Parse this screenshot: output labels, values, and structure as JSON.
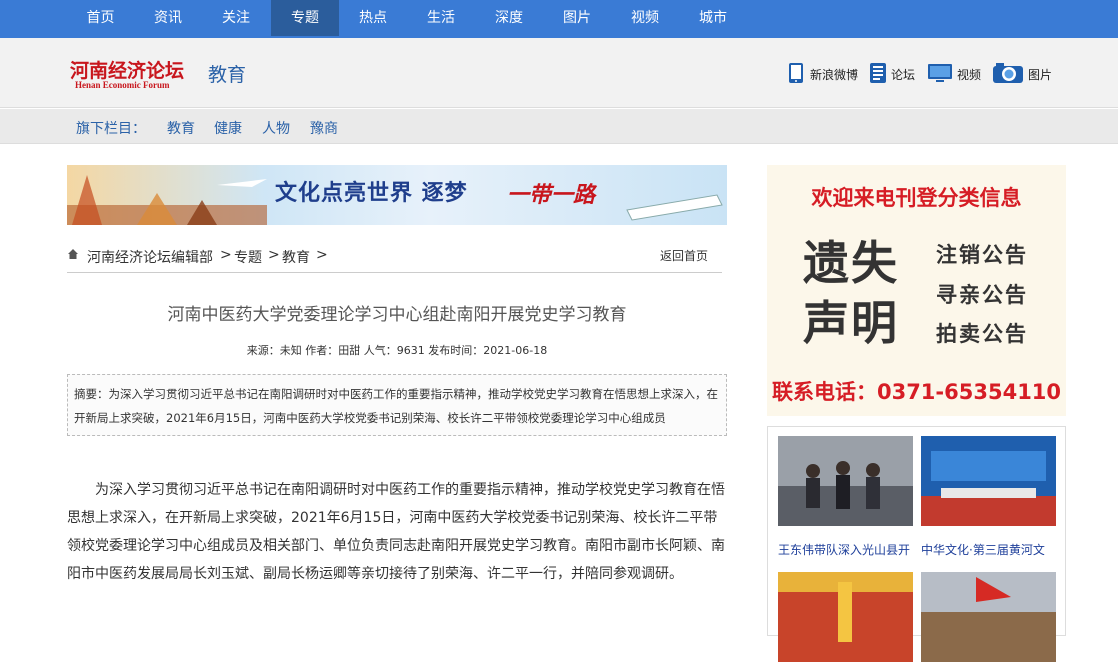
{
  "topnav": [
    "首页",
    "资讯",
    "关注",
    "专题",
    "热点",
    "生活",
    "深度",
    "图片",
    "视频",
    "城市"
  ],
  "header": {
    "logo": "河南经济论坛",
    "logo_en": "Henan Economic Forum",
    "channel": "教育",
    "links": [
      "新浪微博",
      "论坛",
      "视频",
      "图片"
    ]
  },
  "subnav": {
    "label": "旗下栏目：",
    "items": [
      "教育",
      "健康",
      "人物",
      "豫商"
    ]
  },
  "banner": {
    "text": "文化点亮世界  逐梦",
    "text2": "一带一路"
  },
  "breadcrumb": {
    "items": [
      "河南经济论坛编辑部",
      "专题",
      "教育"
    ],
    "sep": ">",
    "back": "返回首页"
  },
  "article": {
    "title": "河南中医药大学党委理论学习中心组赴南阳开展党史学习教育",
    "meta": "来源：未知 作者：田甜 人气：9631 发布时间：2021-06-18",
    "summary": "摘要：为深入学习贯彻习近平总书记在南阳调研时对中医药工作的重要指示精神，推动学校党史学习教育在悟思想上求深入，在开新局上求突破，2021年6月15日，河南中医药大学校党委书记别荣海、校长许二平带领校党委理论学习中心组成员",
    "body": "为深入学习贯彻习近平总书记在南阳调研时对中医药工作的重要指示精神，推动学校党史学习教育在悟思想上求深入，在开新局上求突破，2021年6月15日，河南中医药大学校党委书记别荣海、校长许二平带领校党委理论学习中心组成员及相关部门、单位负责同志赴南阳开展党史学习教育。南阳市副市长阿颖、南阳市中医药发展局局长刘玉斌、副局长杨运卿等亲切接待了别荣海、许二平一行，并陪同参观调研。"
  },
  "ad": {
    "top": "欢迎来电刊登分类信息",
    "big1": "遗失",
    "big2": "声明",
    "items": [
      "注销公告",
      "寻亲公告",
      "拍卖公告"
    ],
    "phone": "联系电话：0371-65354110"
  },
  "photos": [
    {
      "caption": "王东伟带队深入光山县开"
    },
    {
      "caption": "中华文化·第三届黄河文"
    },
    {
      "caption": ""
    },
    {
      "caption": ""
    }
  ],
  "colors": {
    "nav": "#3a7bd5",
    "nav_active": "#2b5d9c",
    "brand_red": "#c8161d",
    "link_blue": "#2b62a8"
  }
}
